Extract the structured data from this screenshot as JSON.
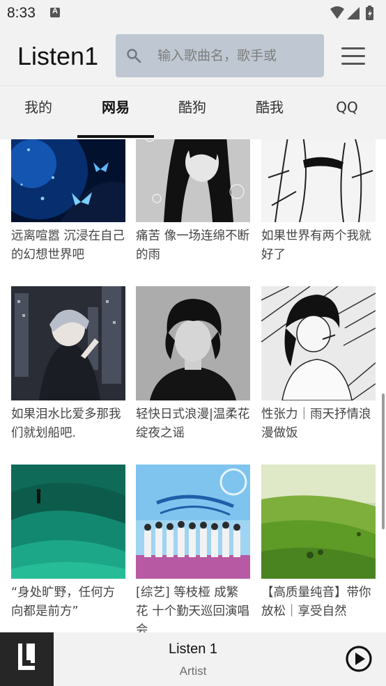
{
  "status_bar": {
    "time": "8:33",
    "notification_icon": "a-notification-icon",
    "icons": [
      "wifi-icon",
      "signal-icon",
      "battery-icon"
    ]
  },
  "app_bar": {
    "title": "Listen1",
    "search_placeholder": "输入歌曲名，歌手或",
    "search_value": "",
    "menu_icon": "hamburger-menu-icon"
  },
  "tabs": [
    {
      "label": "我的",
      "active": false
    },
    {
      "label": "网易",
      "active": true
    },
    {
      "label": "酷狗",
      "active": false
    },
    {
      "label": "酷我",
      "active": false
    },
    {
      "label": "QQ",
      "active": false
    }
  ],
  "playlists": [
    {
      "title": "远离喧嚣 沉浸在自己的幻想世界吧",
      "cover": "blue-butterflies-artwork"
    },
    {
      "title": "痛苦 像一场连绵不断的雨",
      "cover": "monochrome-anime-girl-rain"
    },
    {
      "title": "如果世界有两个我就好了",
      "cover": "sketch-girl-artwork"
    },
    {
      "title": "如果泪水比爱多那我们就划船吧.",
      "cover": "anime-boy-night-city"
    },
    {
      "title": "轻快日式浪漫|温柔花绽夜之谣",
      "cover": "bw-portrait-curly-hair"
    },
    {
      "title": "性张力｜雨天抒情浪漫做饭",
      "cover": "manga-girl-smoking"
    },
    {
      "title": "“身处旷野，任何方向都是前方”",
      "cover": "green-grassland-figure"
    },
    {
      "title": "[综艺] 等枝桠 成繁花 十个勤天巡回演唱会",
      "cover": "group-poster-flowers"
    },
    {
      "title": "【高质量纯音】带你放松｜享受自然",
      "cover": "green-hills-landscape"
    }
  ],
  "player": {
    "logo": "listen1-logo-icon",
    "title": "Listen 1",
    "artist": "Artist",
    "play_icon": "play-circle-icon"
  },
  "colors": {
    "bar_background": "#f2f2f2",
    "search_background": "#bfc8d2",
    "active_indicator": "#111111",
    "text_secondary": "#444444"
  }
}
